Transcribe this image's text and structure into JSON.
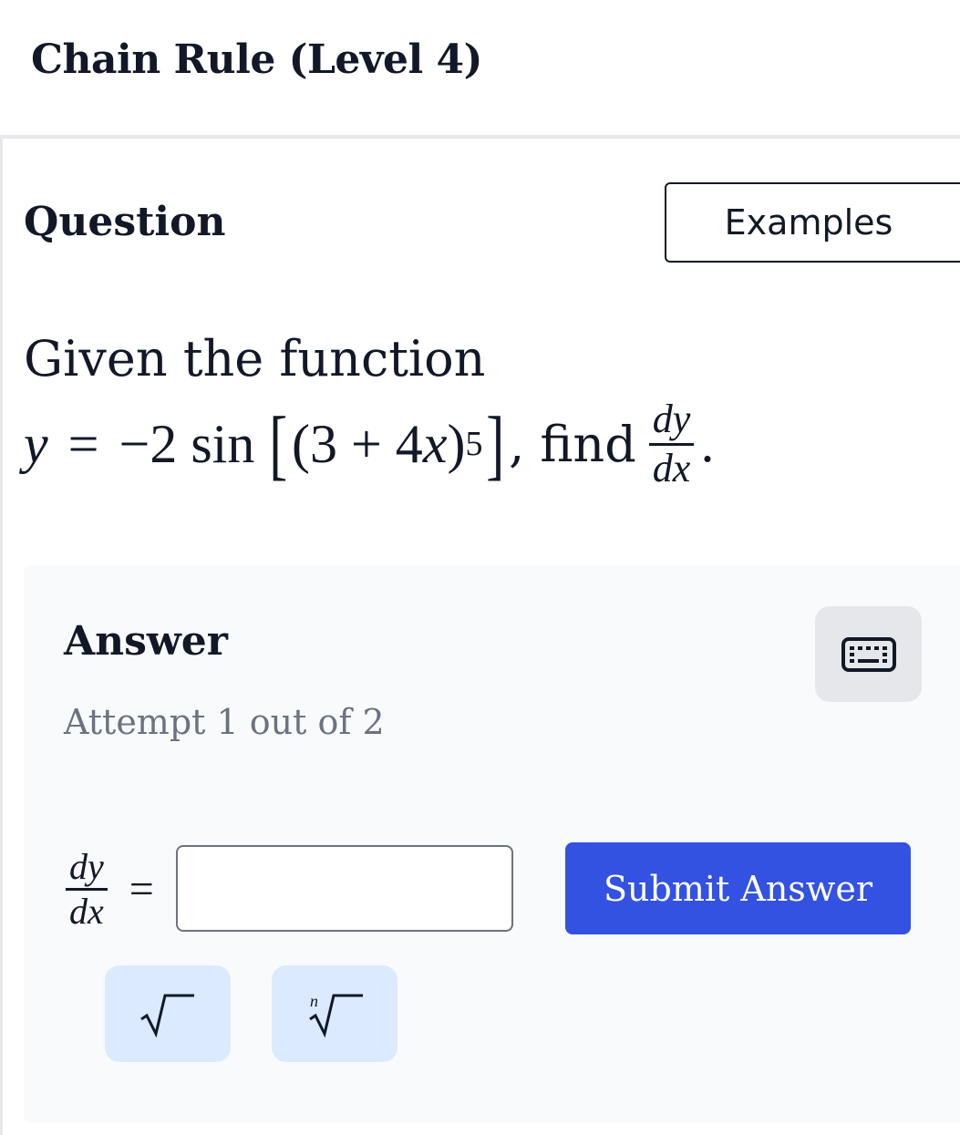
{
  "header": {
    "title": "Chain Rule (Level 4)"
  },
  "question": {
    "heading": "Question",
    "examples_label": "Examples",
    "intro": "Given the function",
    "math": {
      "y": "y",
      "equals": "=",
      "coef": "−2 sin",
      "open_bracket": "[",
      "inner": "(3 + 4",
      "x": "x",
      "close_paren": ")",
      "power": "5",
      "close_bracket": "]",
      "find_text": ", find",
      "dy": "dy",
      "dx": "dx",
      "period": "."
    }
  },
  "answer": {
    "heading": "Answer",
    "attempt": "Attempt 1 out of 2",
    "label_dy": "dy",
    "label_dx": "dx",
    "label_eq": "=",
    "input_value": "",
    "submit_label": "Submit Answer",
    "sqrt_symbol": "√",
    "nroot_index": "n"
  },
  "colors": {
    "primary": "#3352e2",
    "panel": "#f9fafb",
    "tool_button": "#dbeafe",
    "muted_text": "#6b7280"
  },
  "icons": {
    "keyboard": "keyboard-icon",
    "sqrt": "square-root-icon",
    "nroot": "nth-root-icon"
  }
}
